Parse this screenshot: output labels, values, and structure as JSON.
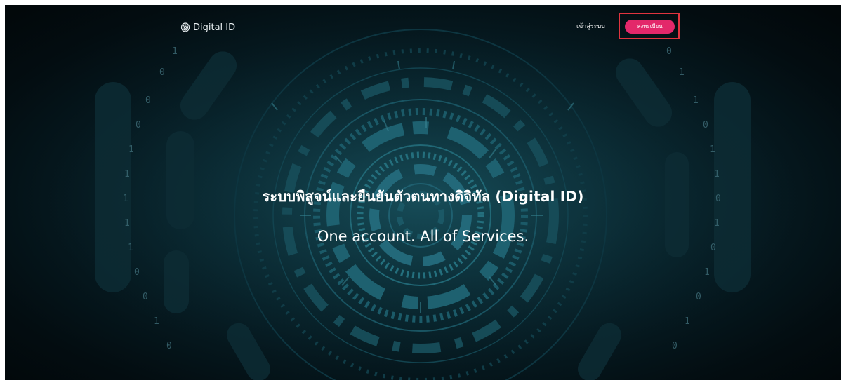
{
  "brand": {
    "name": "Digital ID",
    "icon": "fingerprint-icon"
  },
  "nav": {
    "login_label": "เข้าสู่ระบบ",
    "register_label": "ลงทะเบียน"
  },
  "hero": {
    "title": "ระบบพิสูจน์และยืนยันตัวตนทางดิจิทัล (Digital ID)",
    "subtitle": "One account. All of Services."
  },
  "colors": {
    "accent": "#e3286a",
    "highlight_border": "#e0343f",
    "background": "#061b22"
  }
}
